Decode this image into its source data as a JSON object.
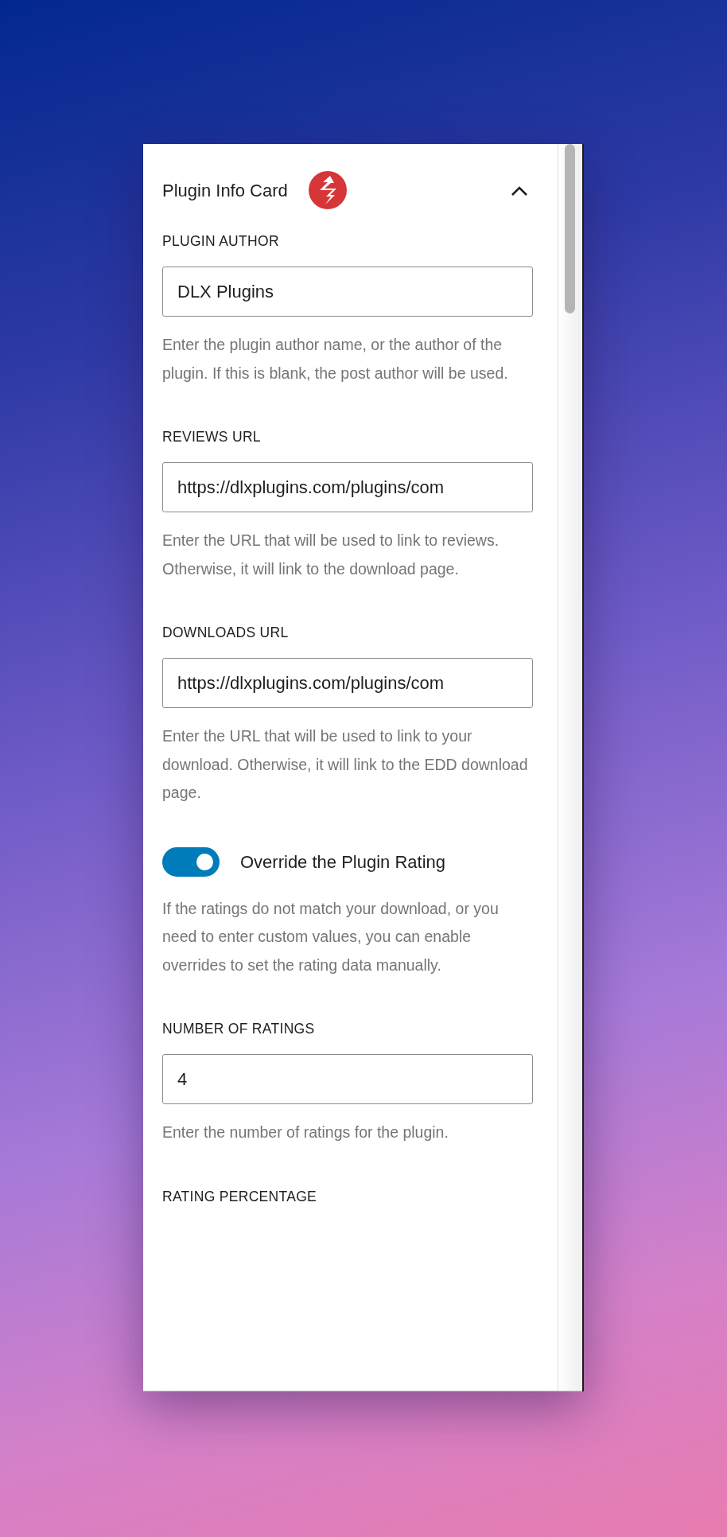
{
  "panel": {
    "title": "Plugin Info Card",
    "expanded": true
  },
  "fields": [
    {
      "kind": "text",
      "label": "PLUGIN AUTHOR",
      "value": "DLX Plugins",
      "help": "Enter the plugin author name, or the author of the plugin. If this is blank, the post author will be used."
    },
    {
      "kind": "text",
      "label": "REVIEWS URL",
      "value": "https://dlxplugins.com/plugins/com",
      "help": "Enter the URL that will be used to link to reviews. Otherwise, it will link to the download page."
    },
    {
      "kind": "text",
      "label": "DOWNLOADS URL",
      "value": "https://dlxplugins.com/plugins/com",
      "help": "Enter the URL that will be used to link to your download. Otherwise, it will link to the EDD download page."
    },
    {
      "kind": "toggle",
      "label": "Override the Plugin Rating",
      "checked": true,
      "help": "If the ratings do not match your download, or you need to enter custom values, you can enable overrides to set the rating data manually."
    },
    {
      "kind": "text",
      "label": "NUMBER OF RATINGS",
      "value": "4",
      "help": "Enter the number of ratings for the plugin."
    },
    {
      "kind": "heading",
      "label": "RATING PERCENTAGE"
    }
  ]
}
